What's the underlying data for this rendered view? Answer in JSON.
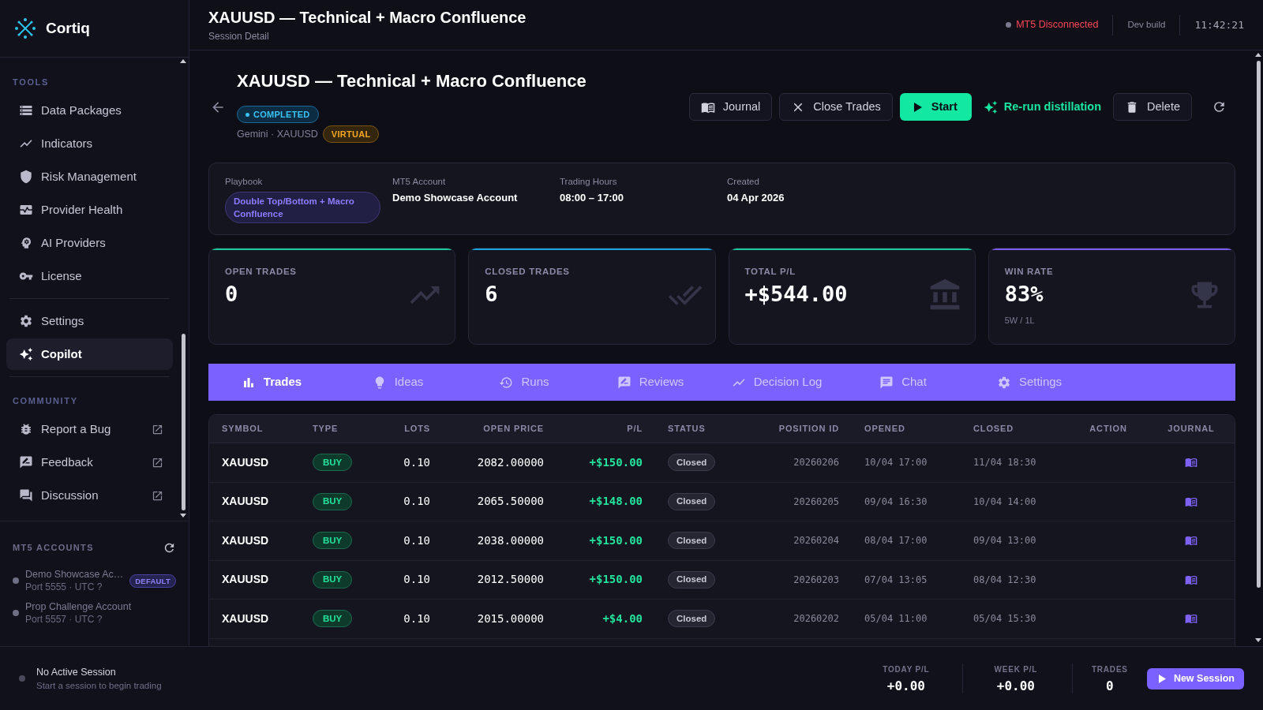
{
  "sidebar": {
    "brand": "Cortiq",
    "sections": [
      {
        "title": "TOOLS",
        "items": [
          {
            "label": "Data Packages",
            "selected": false
          },
          {
            "label": "Indicators",
            "selected": false
          },
          {
            "label": "Risk Management",
            "selected": false
          },
          {
            "label": "Provider Health",
            "selected": false
          },
          {
            "label": "AI Providers",
            "selected": false
          },
          {
            "label": "License",
            "selected": false
          }
        ]
      },
      {
        "items": [
          {
            "label": "Settings",
            "selected": false
          },
          {
            "label": "Copilot",
            "selected": true
          }
        ]
      },
      {
        "title": "COMMUNITY",
        "items": [
          {
            "label": "Report a Bug",
            "selected": false,
            "external": true
          },
          {
            "label": "Feedback",
            "selected": false,
            "external": true
          },
          {
            "label": "Discussion",
            "selected": false,
            "external": true
          }
        ]
      }
    ],
    "accounts": {
      "title": "MT5 ACCOUNTS",
      "items": [
        {
          "name": "Demo Showcase Ac…",
          "detail": "Port 5555 · UTC ?",
          "badge": "DEFAULT"
        },
        {
          "name": "Prop Challenge Account",
          "detail": "Port 5557 · UTC ?"
        }
      ]
    }
  },
  "header": {
    "title": "XAUUSD — Technical + Macro Confluence",
    "subtitle": "Session Detail",
    "connection": "MT5 Disconnected",
    "build": "Dev build",
    "clock": "11:42:21"
  },
  "session": {
    "title": "XAUUSD — Technical + Macro Confluence",
    "status": "COMPLETED",
    "meta": "Gemini · XAUUSD",
    "mode": "VIRTUAL",
    "actions": [
      {
        "label": "Journal",
        "kind": "outline"
      },
      {
        "label": "Close Trades",
        "kind": "outline"
      },
      {
        "label": "Start",
        "kind": "primary"
      },
      {
        "label": "Re-run distillation",
        "kind": "text"
      },
      {
        "label": "Delete",
        "kind": "outline"
      }
    ]
  },
  "details": [
    {
      "label": "Playbook",
      "value": "Double Top/Bottom + Macro Confluence",
      "kind": "pill"
    },
    {
      "label": "MT5 Account",
      "value": "Demo Showcase Account",
      "kind": "text"
    },
    {
      "label": "Trading Hours",
      "value": "08:00 – 17:00",
      "kind": "text"
    },
    {
      "label": "Created",
      "value": "04 Apr 2026",
      "kind": "text"
    }
  ],
  "stats": [
    {
      "label": "OPEN TRADES",
      "value": "0",
      "color": "#19c99a"
    },
    {
      "label": "CLOSED TRADES",
      "value": "6",
      "color": "#1aa3e0"
    },
    {
      "label": "TOTAL P/L",
      "value": "+$544.00",
      "color": "#19c99a"
    },
    {
      "label": "WIN RATE",
      "value": "83%",
      "note": "5W / 1L",
      "color": "#7b5cf0"
    }
  ],
  "tabs": [
    {
      "label": "Trades",
      "selected": true
    },
    {
      "label": "Ideas",
      "selected": false
    },
    {
      "label": "Runs",
      "selected": false
    },
    {
      "label": "Reviews",
      "selected": false
    },
    {
      "label": "Decision Log",
      "selected": false
    },
    {
      "label": "Chat",
      "selected": false
    },
    {
      "label": "Settings",
      "selected": false
    }
  ],
  "table": {
    "columns": [
      "SYMBOL",
      "TYPE",
      "LOTS",
      "OPEN PRICE",
      "P/L",
      "STATUS",
      "POSITION ID",
      "OPENED",
      "CLOSED",
      "ACTION",
      "JOURNAL"
    ],
    "rows": [
      {
        "symbol": "XAUUSD",
        "type": "BUY",
        "lots": "0.10",
        "open_price": "2082.00000",
        "pl": "+$150.00",
        "status": "Closed",
        "position_id": "20260206",
        "opened": "10/04 17:00",
        "closed": "11/04 18:30"
      },
      {
        "symbol": "XAUUSD",
        "type": "BUY",
        "lots": "0.10",
        "open_price": "2065.50000",
        "pl": "+$148.00",
        "status": "Closed",
        "position_id": "20260205",
        "opened": "09/04 16:30",
        "closed": "10/04 14:00"
      },
      {
        "symbol": "XAUUSD",
        "type": "BUY",
        "lots": "0.10",
        "open_price": "2038.00000",
        "pl": "+$150.00",
        "status": "Closed",
        "position_id": "20260204",
        "opened": "08/04 17:00",
        "closed": "09/04 13:00"
      },
      {
        "symbol": "XAUUSD",
        "type": "BUY",
        "lots": "0.10",
        "open_price": "2012.50000",
        "pl": "+$150.00",
        "status": "Closed",
        "position_id": "20260203",
        "opened": "07/04 13:05",
        "closed": "08/04 12:30"
      },
      {
        "symbol": "XAUUSD",
        "type": "BUY",
        "lots": "0.10",
        "open_price": "2015.00000",
        "pl": "+$4.00",
        "status": "Closed",
        "position_id": "20260202",
        "opened": "05/04 11:00",
        "closed": "05/04 15:30"
      }
    ]
  },
  "footer": {
    "session_title": "No Active Session",
    "session_hint": "Start a session to begin trading",
    "stats": [
      {
        "label": "TODAY P/L",
        "value": "+0.00"
      },
      {
        "label": "WEEK P/L",
        "value": "+0.00"
      },
      {
        "label": "TRADES",
        "value": "0"
      }
    ],
    "action": "New Session"
  }
}
